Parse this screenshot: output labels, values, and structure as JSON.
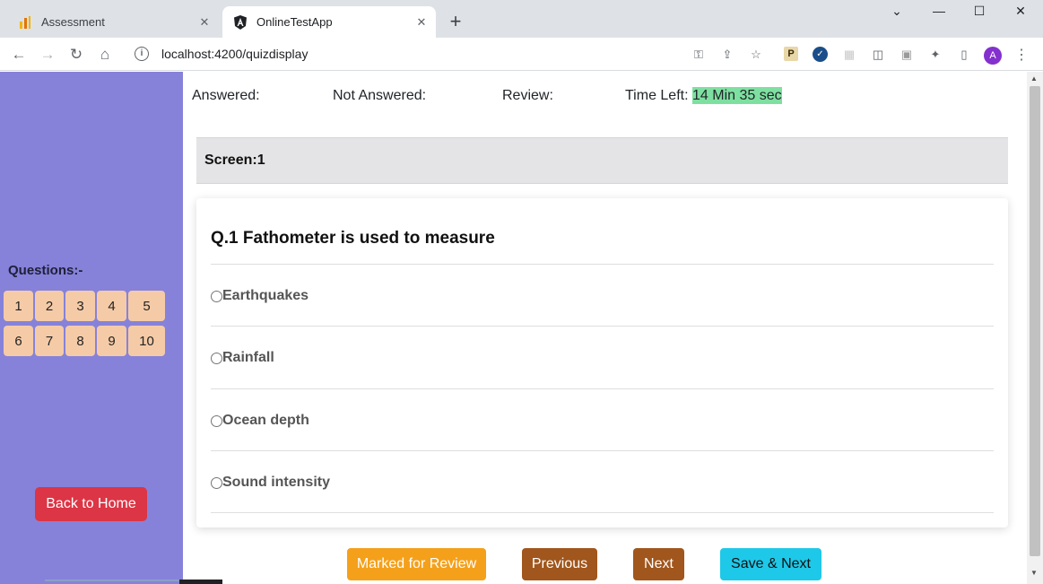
{
  "browser": {
    "tabs": [
      {
        "title": "Assessment",
        "active": false
      },
      {
        "title": "OnlineTestApp",
        "active": true
      }
    ],
    "url": "localhost:4200/quizdisplay",
    "profile_initial": "A",
    "extension_p": "P"
  },
  "status": {
    "answered_label": "Answered:",
    "not_answered_label": "Not Answered:",
    "review_label": "Review:",
    "time_left_label": "Time Left:",
    "time_left_value": "14 Min 35 sec"
  },
  "sidebar": {
    "questions_label": "Questions:-",
    "question_numbers": [
      "1",
      "2",
      "3",
      "4",
      "5",
      "6",
      "7",
      "8",
      "9",
      "10"
    ],
    "back_home_label": "Back to Home"
  },
  "screen_label": "Screen:1",
  "question": {
    "title": "Q.1 Fathometer is used to measure",
    "options": [
      "Earthquakes",
      "Rainfall",
      "Ocean depth",
      "Sound intensity"
    ]
  },
  "actions": {
    "marked_review": "Marked for Review",
    "previous": "Previous",
    "next": "Next",
    "save_next": "Save & Next"
  },
  "colors": {
    "sidebar_bg": "#8682d9",
    "question_btn_bg": "#f5cba7",
    "home_btn": "#dc3545",
    "timer_highlight": "#7ee0a0",
    "marked_review_btn": "#f5a01b",
    "prev_next_btn": "#a0561c",
    "save_next_btn": "#1ec8e8"
  }
}
